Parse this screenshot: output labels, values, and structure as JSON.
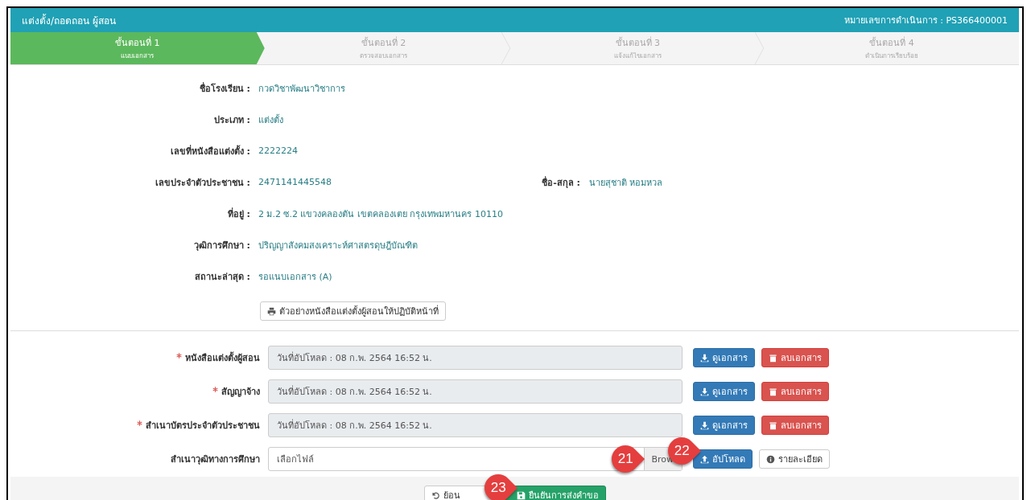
{
  "header": {
    "title": "แต่งตั้ง/ถอดถอน ผู้สอน",
    "reference": "หมายเลขการดำเนินการ : PS366400001"
  },
  "steps": [
    {
      "title": "ขั้นตอนที่ 1",
      "subtitle": "แนบเอกสาร",
      "selected": true
    },
    {
      "title": "ขั้นตอนที่ 2",
      "subtitle": "ตรวจสอบเอกสาร",
      "selected": false
    },
    {
      "title": "ขั้นตอนที่ 3",
      "subtitle": "แจ้งแก้ไขเอกสาร",
      "selected": false
    },
    {
      "title": "ขั้นตอนที่ 4",
      "subtitle": "ดำเนินการเรียบร้อย",
      "selected": false
    }
  ],
  "info": [
    {
      "label": "ชื่อโรงเรียน :",
      "value": "กวดวิชาพัฒนาวิชาการ"
    },
    {
      "label": "ประเภท :",
      "value": "แต่งตั้ง"
    },
    {
      "label": "เลขที่หนังสือแต่งตั้ง :",
      "value": "2222224"
    },
    {
      "label": "เลขประจำตัวประชาชน :",
      "value": "2471141445548",
      "side": {
        "label": "ชื่อ-สกุล :",
        "value": "นายสุชาติ หอมหวล"
      }
    },
    {
      "label": "ที่อยู่ :",
      "value": "2 ม.2 ซ.2 แขวงคลองตัน เขตคลองเตย กรุงเทพมหานคร 10110"
    },
    {
      "label": "วุฒิการศึกษา :",
      "value": "ปริญญาสังคมสงเคราะห์ศาสตรดุษฎีบัณฑิต"
    },
    {
      "label": "สถานะล่าสุด :",
      "value": "รอแนบเอกสาร (A)"
    }
  ],
  "sample_button": "ตัวอย่างหนังสือแต่งตั้งผู้สอนให้ปฏิบัติหน้าที่",
  "documents": [
    {
      "kind": "uploaded",
      "required": true,
      "label": "หนังสือแต่งตั้งผู้สอน",
      "value": "วันที่อัปโหลด  :  08 ก.พ. 2564 16:52 น.",
      "view_button": "ดูเอกสาร",
      "delete_button": "ลบเอกสาร"
    },
    {
      "kind": "uploaded",
      "required": true,
      "label": "สัญญาจ้าง",
      "value": "วันที่อัปโหลด  :  08 ก.พ. 2564 16:52 น.",
      "view_button": "ดูเอกสาร",
      "delete_button": "ลบเอกสาร"
    },
    {
      "kind": "uploaded",
      "required": true,
      "label": "สำเนาบัตรประจำตัวประชาชน",
      "value": "วันที่อัปโหลด  :  08 ก.พ. 2564 16:52 น.",
      "view_button": "ดูเอกสาร",
      "delete_button": "ลบเอกสาร"
    },
    {
      "kind": "file",
      "required": false,
      "label": "สำเนาวุฒิทางการศึกษา",
      "placeholder": "เลือกไฟล์",
      "browse_button": "Brow",
      "upload_button": "อัปโหลด",
      "detail_button": "รายละเอียด"
    }
  ],
  "footer": {
    "back_button": "ย้อน",
    "confirm_button": "ยืนยันการส่งคำขอ"
  },
  "callouts": [
    "21",
    "22",
    "23"
  ]
}
